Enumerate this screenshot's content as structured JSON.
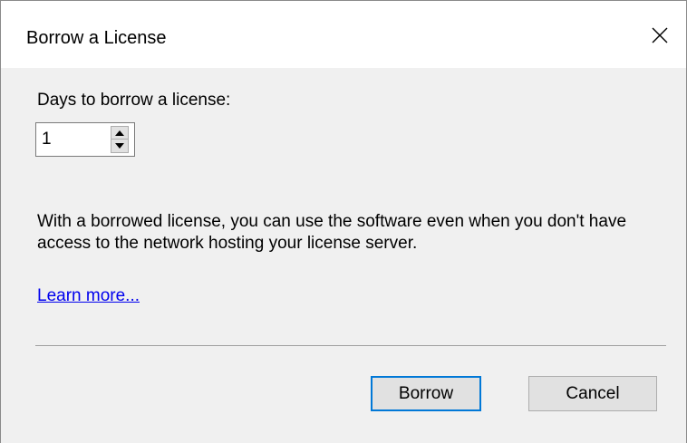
{
  "window": {
    "title": "Borrow a License"
  },
  "form": {
    "days_label": "Days to borrow a license:",
    "days_value": "1",
    "description": "With a borrowed license, you can use the software even when you don't have access to the network hosting your license server.",
    "learn_more": "Learn more..."
  },
  "buttons": {
    "borrow": "Borrow",
    "cancel": "Cancel"
  },
  "icons": {
    "close": "close-icon",
    "spin_up": "triangle-up-icon",
    "spin_down": "triangle-down-icon"
  },
  "colors": {
    "link": "#0000ee",
    "default_button_border": "#0078d7"
  }
}
